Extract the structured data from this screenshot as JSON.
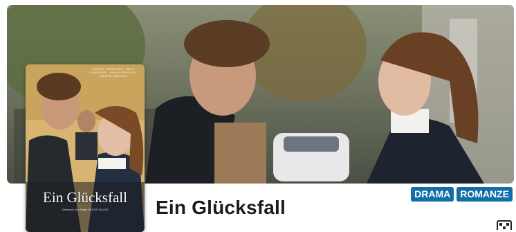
{
  "movie": {
    "title": "Ein Glücksfall",
    "poster_title": "Ein Glücksfall",
    "poster_credits": "VALÉRIE LEMERCIER · NIELS SCHNEIDER · MELVIL POUPAUD · VALÉRIE DONZELLI",
    "poster_subtitle": "Drehbuch und Regie WOODY ALLEN"
  },
  "genres": [
    "DRAMA",
    "ROMANZE"
  ],
  "icons": {
    "qr": "qr-code-icon"
  },
  "colors": {
    "tag_bg": "#0f6fa6",
    "title": "#1b1b1b"
  }
}
